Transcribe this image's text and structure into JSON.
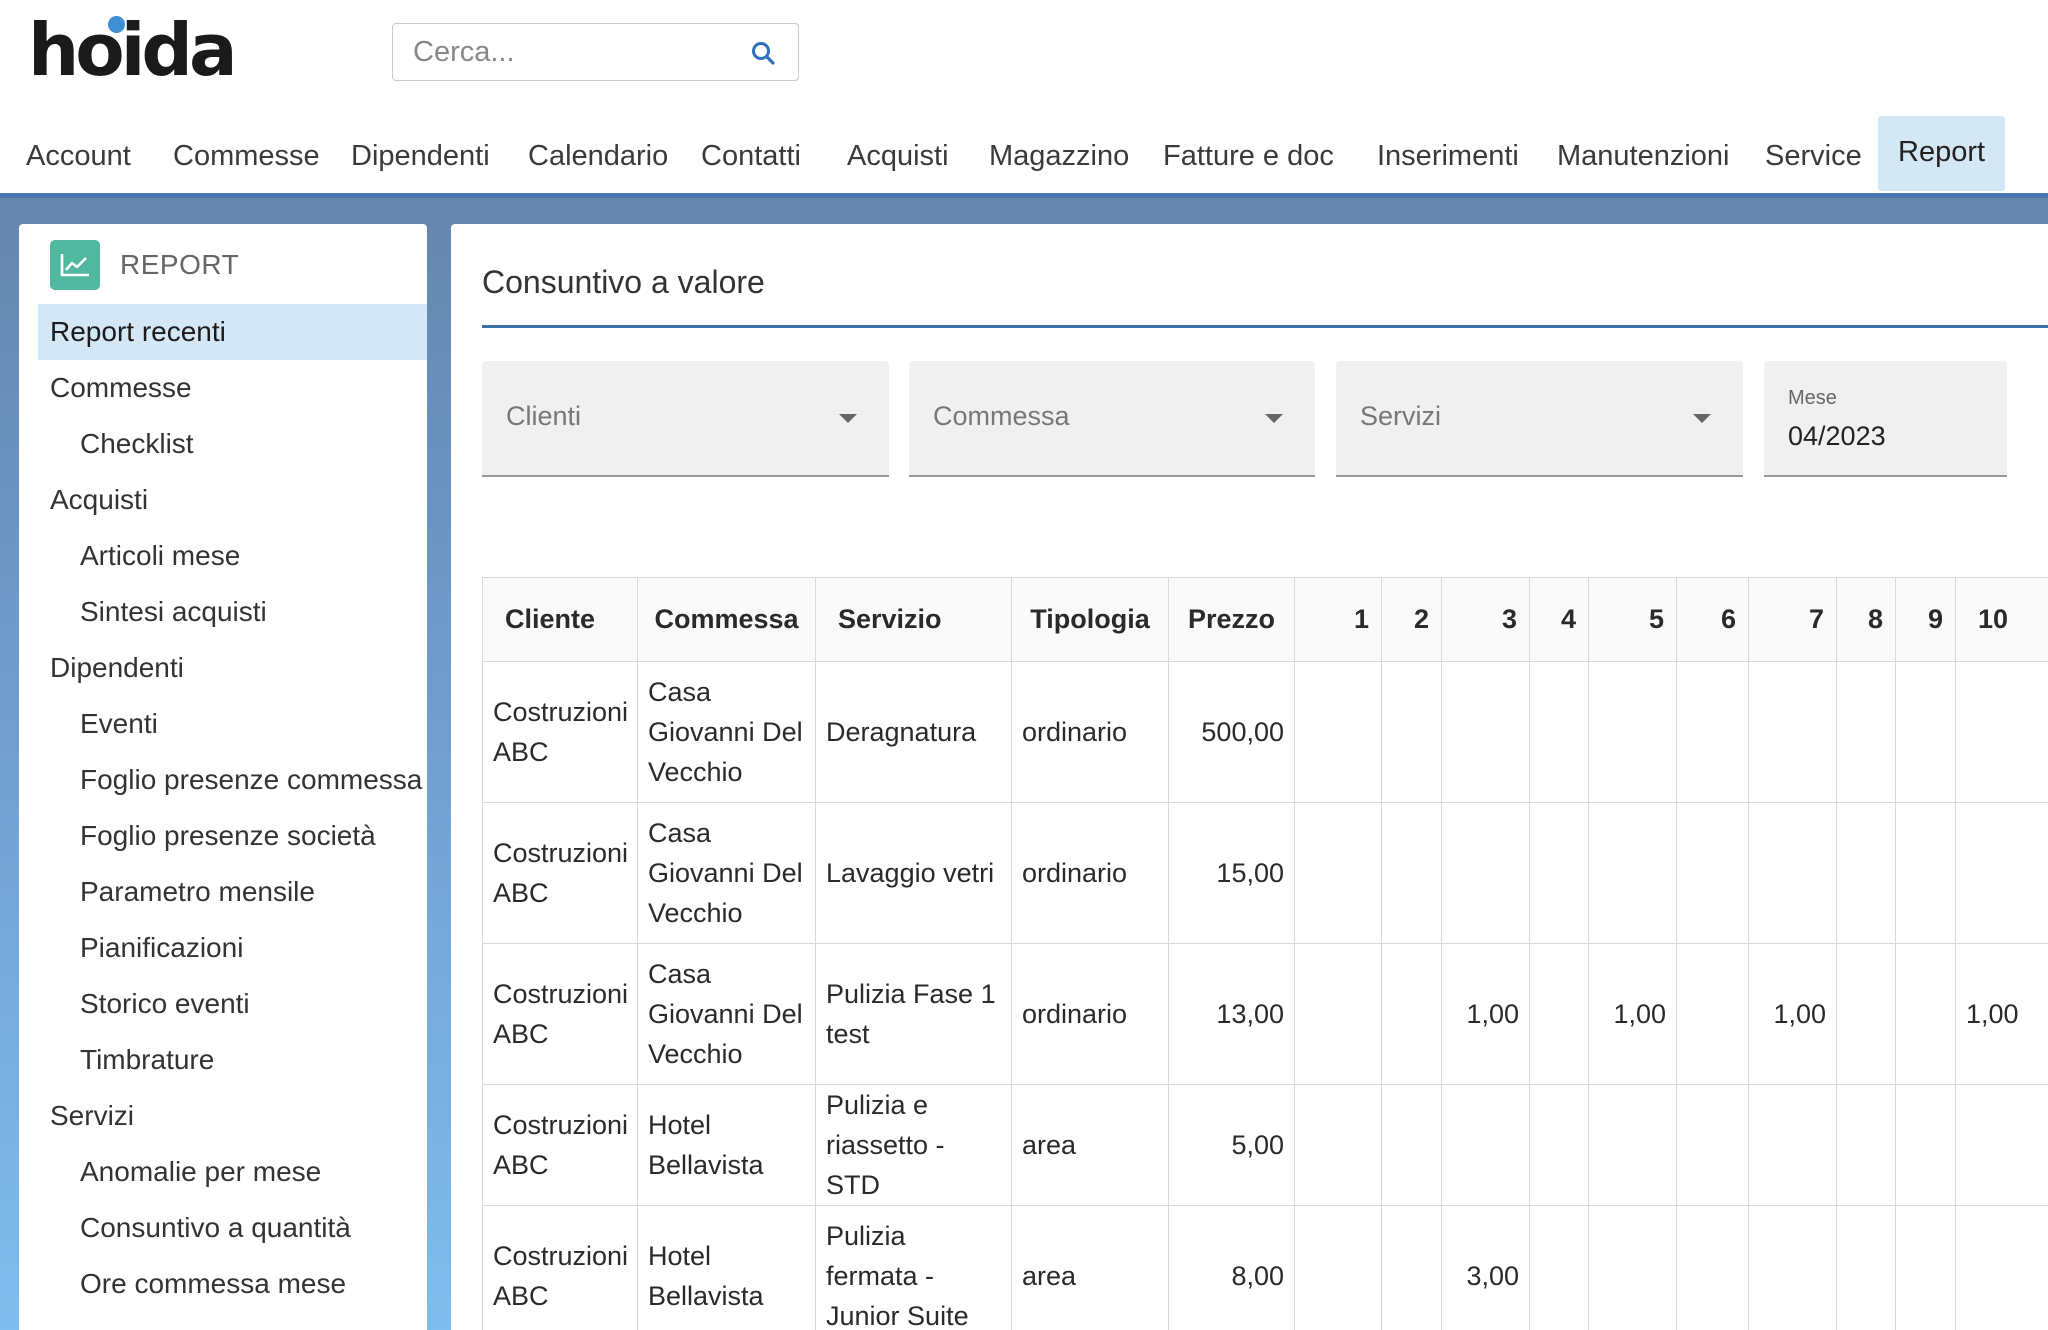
{
  "header": {
    "logo": "hoida",
    "search_placeholder": "Cerca..."
  },
  "nav": {
    "items": [
      "Account",
      "Commesse",
      "Dipendenti",
      "Calendario",
      "Contatti",
      "Acquisti",
      "Magazzino",
      "Fatture e doc",
      "Inserimenti",
      "Manutenzioni",
      "Service",
      "Report"
    ],
    "active": "Report"
  },
  "sidebar": {
    "title": "REPORT",
    "items": [
      {
        "label": "Report recenti",
        "level": 0,
        "active": true
      },
      {
        "label": "Commesse",
        "level": 0
      },
      {
        "label": "Checklist",
        "level": 1
      },
      {
        "label": "Acquisti",
        "level": 0
      },
      {
        "label": "Articoli mese",
        "level": 1
      },
      {
        "label": "Sintesi acquisti",
        "level": 1
      },
      {
        "label": "Dipendenti",
        "level": 0
      },
      {
        "label": "Eventi",
        "level": 1
      },
      {
        "label": "Foglio presenze commessa",
        "level": 1
      },
      {
        "label": "Foglio presenze società",
        "level": 1
      },
      {
        "label": "Parametro mensile",
        "level": 1
      },
      {
        "label": "Pianificazioni",
        "level": 1
      },
      {
        "label": "Storico eventi",
        "level": 1
      },
      {
        "label": "Timbrature",
        "level": 1
      },
      {
        "label": "Servizi",
        "level": 0
      },
      {
        "label": "Anomalie per mese",
        "level": 1
      },
      {
        "label": "Consuntivo a quantità",
        "level": 1
      },
      {
        "label": "Ore commessa mese",
        "level": 1
      }
    ]
  },
  "main": {
    "title": "Consuntivo a valore",
    "filters": {
      "clienti": "Clienti",
      "commessa": "Commessa",
      "servizi": "Servizi",
      "mese_label": "Mese",
      "mese_value": "04/2023"
    }
  },
  "table": {
    "columns": [
      "Cliente",
      "Commessa",
      "Servizio",
      "Tipologia",
      "Prezzo",
      "1",
      "2",
      "3",
      "4",
      "5",
      "6",
      "7",
      "8",
      "9",
      "10"
    ],
    "rows": [
      {
        "cliente": "Costruzioni ABC",
        "commessa": "Casa Giovanni Del Vecchio",
        "servizio": "Deragnatura",
        "tipologia": "ordinario",
        "prezzo": "500,00",
        "days": [
          "",
          "",
          "",
          "",
          "",
          "",
          "",
          "",
          "",
          ""
        ]
      },
      {
        "cliente": "Costruzioni ABC",
        "commessa": "Casa Giovanni Del Vecchio",
        "servizio": "Lavaggio vetri",
        "tipologia": "ordinario",
        "prezzo": "15,00",
        "days": [
          "",
          "",
          "",
          "",
          "",
          "",
          "",
          "",
          "",
          ""
        ]
      },
      {
        "cliente": "Costruzioni ABC",
        "commessa": "Casa Giovanni Del Vecchio",
        "servizio": "Pulizia Fase 1 test",
        "tipologia": "ordinario",
        "prezzo": "13,00",
        "days": [
          "",
          "",
          "1,00",
          "",
          "1,00",
          "",
          "1,00",
          "",
          "",
          "1,00"
        ]
      },
      {
        "cliente": "Costruzioni ABC",
        "commessa": "Hotel Bellavista",
        "servizio": "Pulizia e riassetto - STD",
        "tipologia": "area",
        "prezzo": "5,00",
        "days": [
          "",
          "",
          "",
          "",
          "",
          "",
          "",
          "",
          "",
          ""
        ]
      },
      {
        "cliente": "Costruzioni ABC",
        "commessa": "Hotel Bellavista",
        "servizio": "Pulizia fermata - Junior Suite",
        "tipologia": "area",
        "prezzo": "8,00",
        "days": [
          "",
          "",
          "3,00",
          "",
          "",
          "",
          "",
          "",
          "",
          ""
        ]
      }
    ]
  }
}
